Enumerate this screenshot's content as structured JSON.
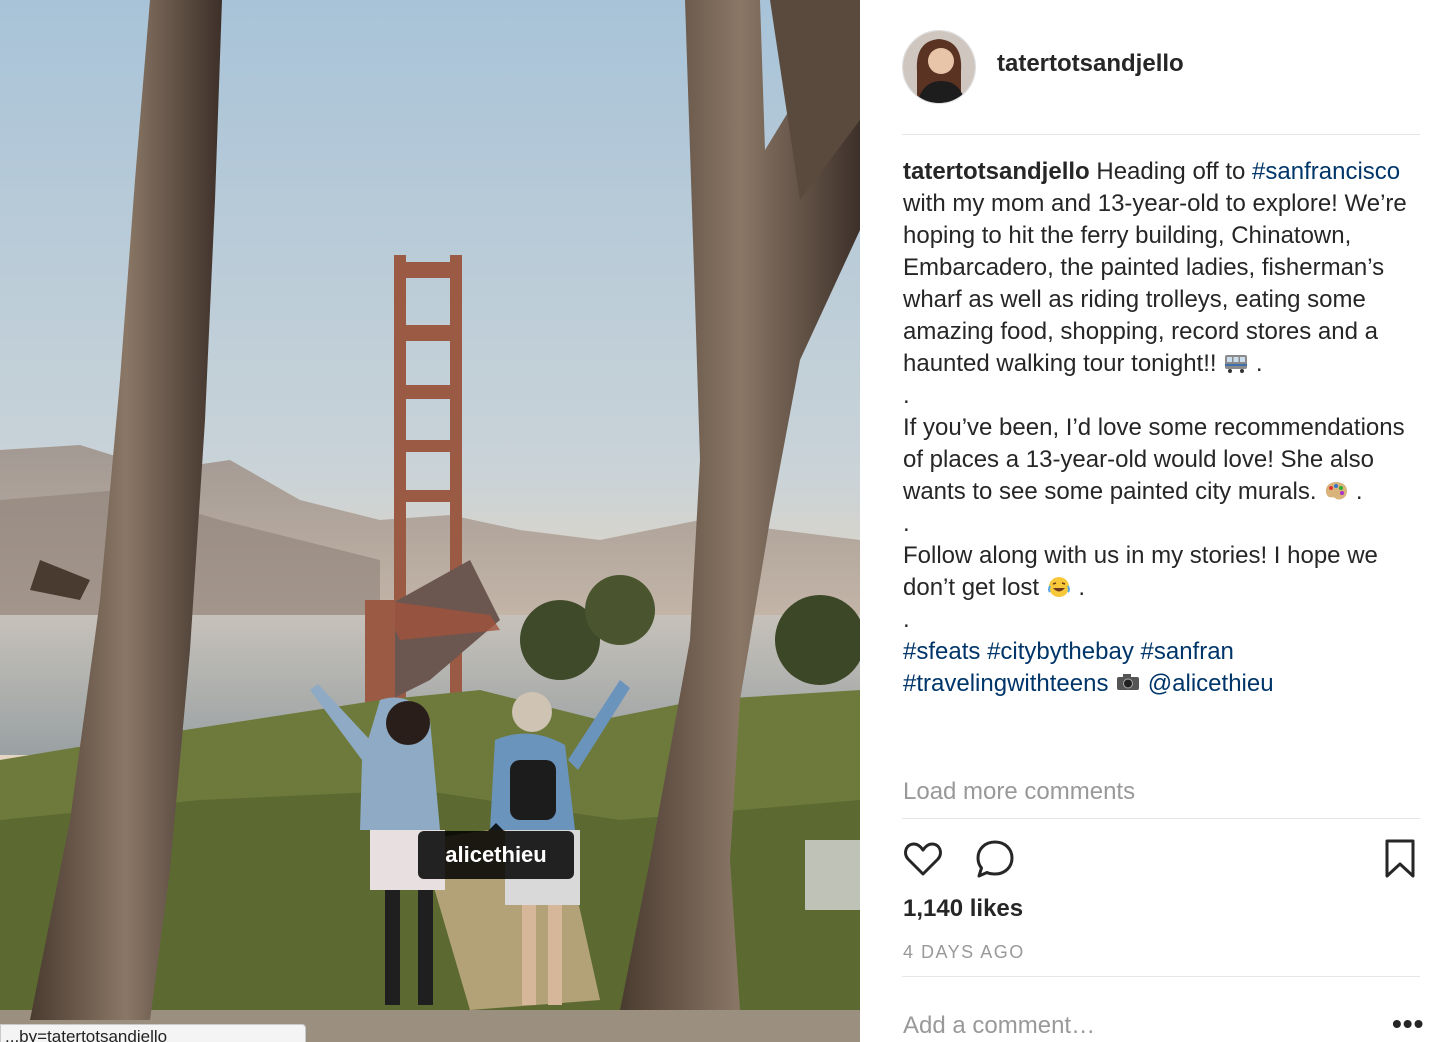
{
  "post": {
    "username": "tatertotsandjello",
    "photo_tag": "alicethieu",
    "status_link": "...by=tatertotsandjello"
  },
  "caption": {
    "username": "tatertotsandjello",
    "line1_pre": " Heading off to ",
    "hashtag_sf": "#sanfrancisco",
    "line1_post": " with my mom and 13-year-old to explore! We’re hoping to hit the ferry building, Chinatown, Embarcadero, the painted ladies, fisherman’s wharf as well as riding trolleys, eating some amazing food, shopping, record stores and a haunted walking tour tonight!! ",
    "emoji1": "trolley-emoji",
    "dot1_end": " .",
    "dot": ".",
    "para2": "If you’ve been, I’d love some recommendations of places a 13-year-old would love! She also wants to see some painted city murals. ",
    "emoji2": "palette-emoji",
    "dot2_end": " .",
    "para3": "Follow along with us in my stories! I hope we don’t get lost ",
    "emoji3": "laughing-emoji",
    "dot3_end": " .",
    "tags": [
      "#sfeats",
      "#citybythebay",
      "#sanfran",
      "#travelingwithteens"
    ],
    "emoji4": "camera-emoji",
    "mention": "@alicethieu"
  },
  "load_more": "Load more comments",
  "likes": "1,140 likes",
  "date": "4 DAYS AGO",
  "comment_placeholder": "Add a comment…",
  "more_label": "•••",
  "colors": {
    "link": "#003569",
    "muted": "#999999",
    "text": "#262626",
    "divider": "#e6e6e6"
  }
}
